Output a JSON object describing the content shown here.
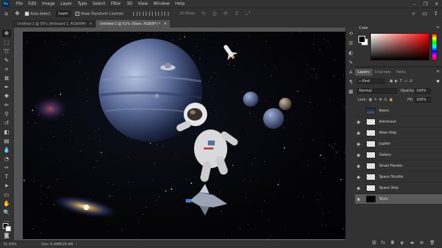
{
  "app": {
    "logo": "Ps"
  },
  "menu": [
    "File",
    "Edit",
    "Image",
    "Layer",
    "Type",
    "Select",
    "Filter",
    "3D",
    "View",
    "Window",
    "Help"
  ],
  "window_controls": [
    "–",
    "❐",
    "✕"
  ],
  "options_bar": {
    "auto_select_label": "Auto-Select:",
    "auto_select_checked": true,
    "auto_select_target": "Layer",
    "show_transform_label": "Show Transform Controls",
    "mode_3d_label": "3D Mode:"
  },
  "tabs": [
    {
      "label": "Untitled-1 @ 50% (Artboard 1, RGB/8#)",
      "active": false
    },
    {
      "label": "Untitled-2 @ 51% (Stars, RGB/8*) *",
      "active": true
    }
  ],
  "status": {
    "zoom": "51.03%",
    "doc": "Doc: 6.49M/29.4M"
  },
  "color_panel": {
    "tab": "Color",
    "foreground": "#000000",
    "background": "#ffffff"
  },
  "layers_panel": {
    "tabs": [
      "Layers",
      "Channels",
      "Paths"
    ],
    "filter_kind": "Kind",
    "blend_mode": "Normal",
    "opacity_label": "Opacity:",
    "opacity": "100%",
    "lock_label": "Lock:",
    "fill_label": "Fill:",
    "fill": "100%",
    "layers": [
      {
        "name": "Room",
        "visible": false,
        "thumb": "room",
        "selected": false
      },
      {
        "name": "Astronaut",
        "visible": true,
        "thumb": "transparent",
        "selected": false
      },
      {
        "name": "Alien Ship",
        "visible": true,
        "thumb": "transparent",
        "selected": false
      },
      {
        "name": "Jupiter",
        "visible": true,
        "thumb": "transparent",
        "selected": false
      },
      {
        "name": "Galaxy",
        "visible": true,
        "thumb": "transparent",
        "selected": false
      },
      {
        "name": "Small Planets",
        "visible": true,
        "thumb": "transparent",
        "selected": false
      },
      {
        "name": "Space Shuttle",
        "visible": true,
        "thumb": "transparent",
        "selected": false
      },
      {
        "name": "Space Ship",
        "visible": true,
        "thumb": "transparent",
        "selected": false
      },
      {
        "name": "Stars",
        "visible": true,
        "thumb": "dark",
        "selected": true
      }
    ]
  }
}
